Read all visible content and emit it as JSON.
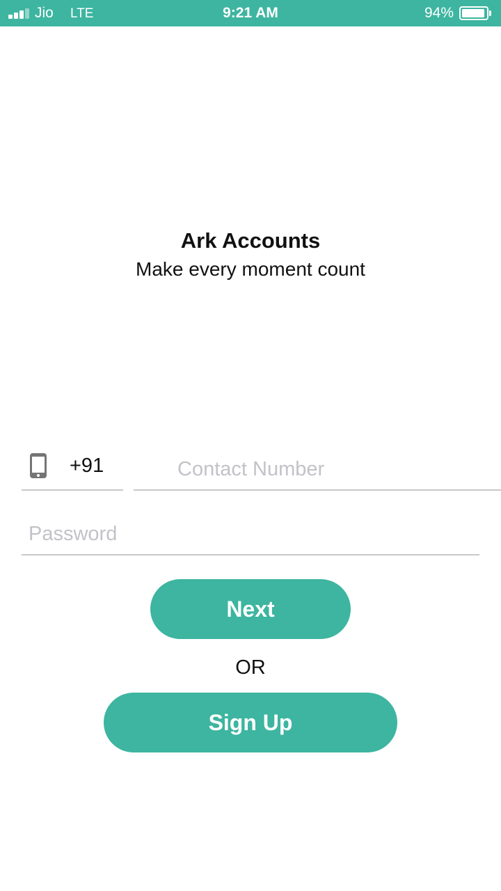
{
  "status_bar": {
    "carrier": "Jio",
    "network": "LTE",
    "time": "9:21 AM",
    "battery_percent": "94%",
    "battery_level": 0.94,
    "signal_bars": 3,
    "signal_bars_total": 4,
    "background_color": "#3db5a0"
  },
  "header": {
    "title": "Ark Accounts",
    "tagline": "Make every moment count"
  },
  "login_form": {
    "phone_icon": "mobile-phone-icon",
    "country_code": "+91",
    "contact_placeholder": "Contact Number",
    "contact_value": "",
    "password_placeholder": "Password",
    "password_value": "",
    "next_label": "Next",
    "or_label": "OR",
    "signup_label": "Sign Up"
  },
  "colors": {
    "accent": "#3db5a0",
    "placeholder": "#c2c2c8",
    "underline": "#c8c8c8",
    "text": "#111111"
  }
}
